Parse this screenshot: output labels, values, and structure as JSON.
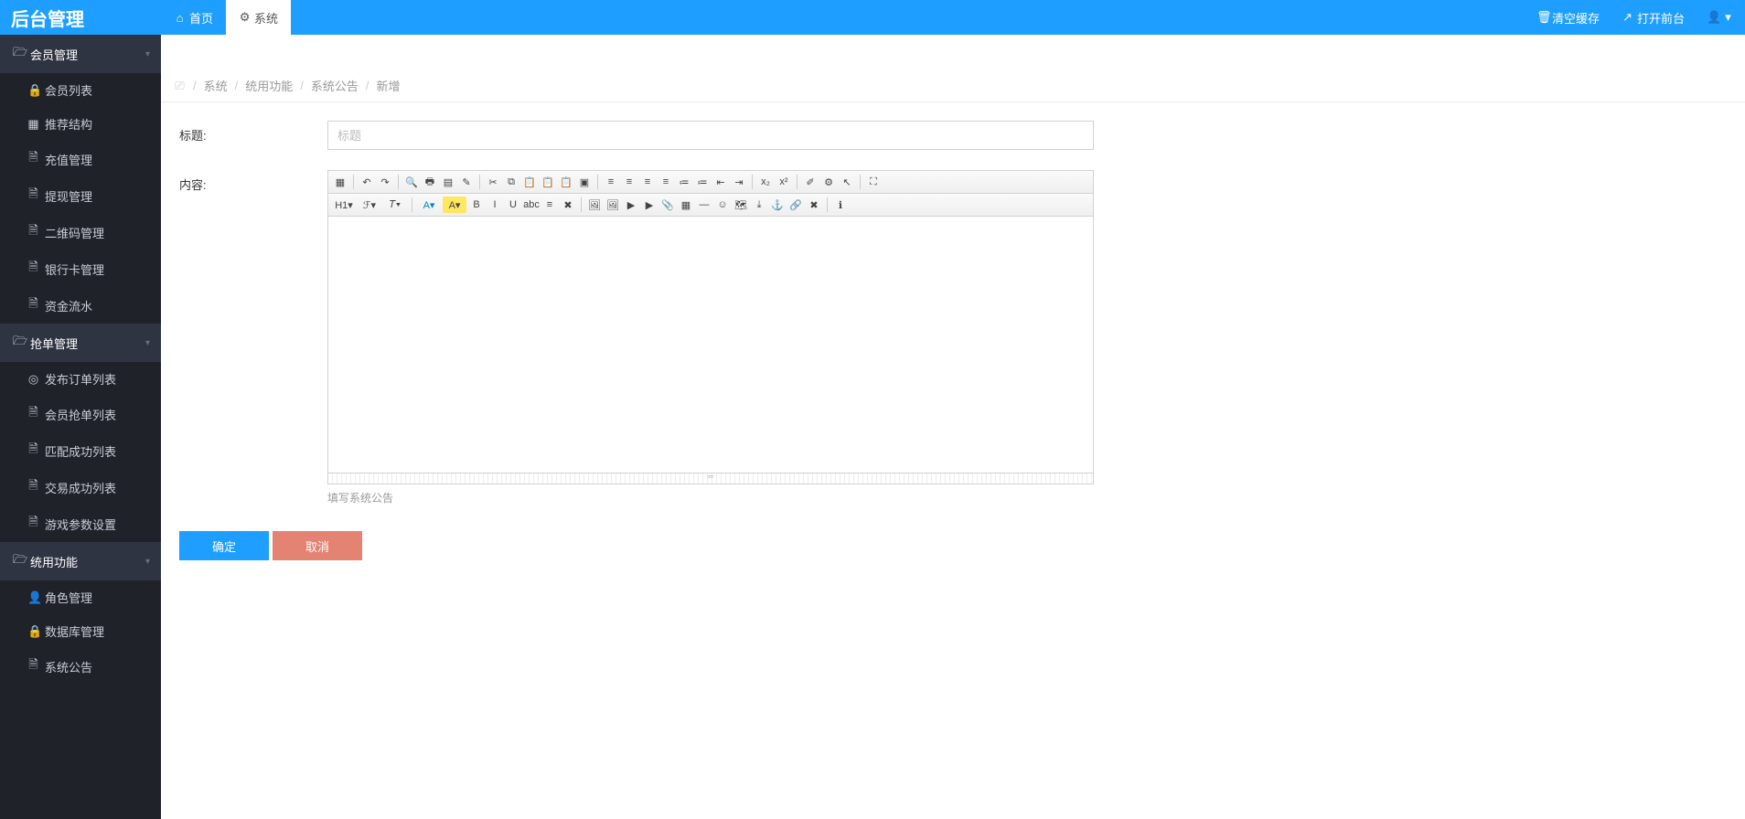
{
  "app_title": "后台管理",
  "tabs": [
    {
      "label": "首页",
      "icon": "home"
    },
    {
      "label": "系统",
      "icon": "gear",
      "active": true
    }
  ],
  "top_actions": {
    "clear_cache": "清空缓存",
    "open_front": "打开前台"
  },
  "sidebar": [
    {
      "label": "会员管理",
      "icon": "folder",
      "items": [
        {
          "label": "会员列表",
          "icon": "lock"
        },
        {
          "label": "推荐结构",
          "icon": "grid"
        },
        {
          "label": "充值管理",
          "icon": "file"
        },
        {
          "label": "提现管理",
          "icon": "file"
        },
        {
          "label": "二维码管理",
          "icon": "file"
        },
        {
          "label": "银行卡管理",
          "icon": "file"
        },
        {
          "label": "资金流水",
          "icon": "file"
        }
      ]
    },
    {
      "label": "抢单管理",
      "icon": "folder",
      "items": [
        {
          "label": "发布订单列表",
          "icon": "ring"
        },
        {
          "label": "会员抢单列表",
          "icon": "file"
        },
        {
          "label": "匹配成功列表",
          "icon": "file"
        },
        {
          "label": "交易成功列表",
          "icon": "file"
        },
        {
          "label": "游戏参数设置",
          "icon": "file"
        }
      ]
    },
    {
      "label": "统用功能",
      "icon": "folder",
      "items": [
        {
          "label": "角色管理",
          "icon": "user"
        },
        {
          "label": "数据库管理",
          "icon": "lock"
        },
        {
          "label": "系统公告",
          "icon": "file"
        }
      ]
    }
  ],
  "breadcrumb": {
    "items": [
      "系统",
      "统用功能",
      "系统公告",
      "新增"
    ]
  },
  "form": {
    "title_label": "标题:",
    "title_placeholder": "标题",
    "title_value": "",
    "content_label": "内容:",
    "help_text": "填写系统公告",
    "submit": "确定",
    "cancel": "取消"
  },
  "editor_toolbar": {
    "row1": [
      {
        "name": "source",
        "g": "▦"
      },
      {
        "sep": 1
      },
      {
        "name": "undo",
        "g": "↶"
      },
      {
        "name": "redo",
        "g": "↷"
      },
      {
        "sep": 1
      },
      {
        "name": "preview",
        "g": "🔍"
      },
      {
        "name": "print",
        "g": "🖶"
      },
      {
        "name": "template",
        "g": "▤"
      },
      {
        "name": "code",
        "g": "✎"
      },
      {
        "sep": 1
      },
      {
        "name": "cut",
        "g": "✂"
      },
      {
        "name": "copy",
        "g": "⧉"
      },
      {
        "name": "paste",
        "g": "📋"
      },
      {
        "name": "paste-plain",
        "g": "📋"
      },
      {
        "name": "paste-word",
        "g": "📋"
      },
      {
        "name": "select-all",
        "g": "▣"
      },
      {
        "sep": 1
      },
      {
        "name": "align-left",
        "g": "≡"
      },
      {
        "name": "align-center",
        "g": "≡"
      },
      {
        "name": "align-right",
        "g": "≡"
      },
      {
        "name": "align-justify",
        "g": "≡"
      },
      {
        "name": "list-ol",
        "g": "≔"
      },
      {
        "name": "list-ul",
        "g": "≔"
      },
      {
        "name": "outdent",
        "g": "⇤"
      },
      {
        "name": "indent",
        "g": "⇥"
      },
      {
        "sep": 1
      },
      {
        "name": "subscript",
        "g": "x₂"
      },
      {
        "name": "superscript",
        "g": "x²"
      },
      {
        "sep": 1
      },
      {
        "name": "clear-format",
        "g": "✐"
      },
      {
        "name": "quick-format",
        "g": "⚙"
      },
      {
        "name": "select-el",
        "g": "↖"
      },
      {
        "sep": 1
      },
      {
        "name": "fullscreen",
        "g": "⛶"
      }
    ],
    "row2": [
      {
        "name": "format-block",
        "g": "H1▾",
        "wide": 1
      },
      {
        "name": "font-family",
        "g": "ℱ▾",
        "wide": 1
      },
      {
        "name": "font-size",
        "g": "𝑇▾",
        "wide": 1
      },
      {
        "sep": 1
      },
      {
        "name": "fore-color",
        "g": "A▾",
        "color": "#08c",
        "wide": 1
      },
      {
        "name": "back-color",
        "g": "A▾",
        "bg": "#ffe761",
        "wide": 1
      },
      {
        "name": "bold",
        "g": "B"
      },
      {
        "name": "italic",
        "g": "I"
      },
      {
        "name": "underline",
        "g": "U"
      },
      {
        "name": "strike",
        "g": "abc"
      },
      {
        "name": "line-height",
        "g": "≡"
      },
      {
        "name": "remove-format",
        "g": "✖"
      },
      {
        "sep": 1
      },
      {
        "name": "image",
        "g": "🖼"
      },
      {
        "name": "multi-image",
        "g": "🖼"
      },
      {
        "name": "flash",
        "g": "▶"
      },
      {
        "name": "media",
        "g": "▶"
      },
      {
        "name": "file",
        "g": "📎"
      },
      {
        "name": "table",
        "g": "▦"
      },
      {
        "name": "hr",
        "g": "—"
      },
      {
        "name": "emoji",
        "g": "☺"
      },
      {
        "name": "baidu-map",
        "g": "🗺"
      },
      {
        "name": "pagebreak",
        "g": "⤓"
      },
      {
        "name": "anchor",
        "g": "⚓"
      },
      {
        "name": "link",
        "g": "🔗"
      },
      {
        "name": "unlink",
        "g": "✖"
      },
      {
        "sep": 1
      },
      {
        "name": "about",
        "g": "ℹ"
      }
    ]
  }
}
